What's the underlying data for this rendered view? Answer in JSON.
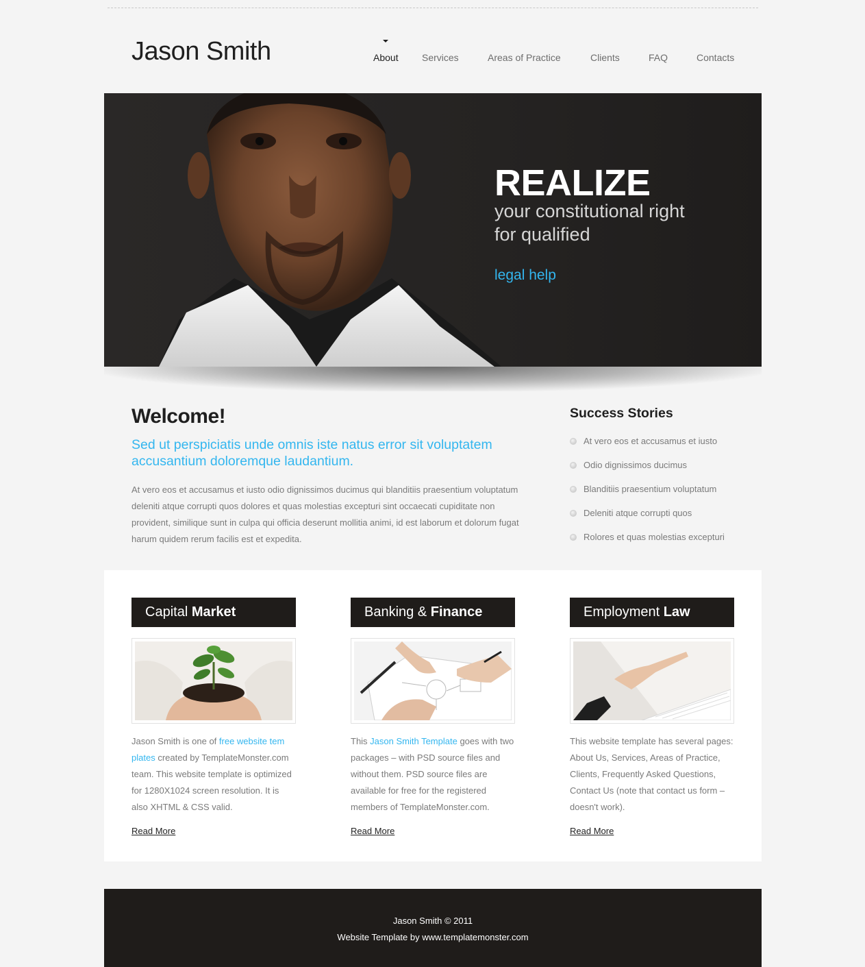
{
  "header": {
    "logo": "Jason Smith",
    "nav": [
      {
        "label": "About",
        "active": true
      },
      {
        "label": "Services",
        "active": false
      },
      {
        "label": "Areas of Practice",
        "active": false
      },
      {
        "label": "Clients",
        "active": false
      },
      {
        "label": "FAQ",
        "active": false
      },
      {
        "label": "Contacts",
        "active": false
      }
    ]
  },
  "hero": {
    "title": "REALIZE",
    "line1": "your constitutional right",
    "line2": "for qualified",
    "link": "legal help"
  },
  "welcome": {
    "title": "Welcome!",
    "lead": "Sed ut perspiciatis unde omnis iste natus error sit voluptatem accusantium doloremque laudantium.",
    "body": "At vero eos et accusamus et iusto odio dignissimos ducimus qui blanditiis praesentium voluptatum deleniti atque corrupti quos dolores et quas molestias excepturi sint occaecati cupiditate non provident, similique sunt in culpa qui officia deserunt mollitia animi, id est laborum et dolorum fugat harum quidem rerum facilis est et expedita."
  },
  "stories": {
    "title": "Success Stories",
    "items": [
      "At vero eos et accusamus et iusto",
      "Odio dignissimos ducimus",
      "Blanditiis praesentium voluptatum",
      "Deleniti atque corrupti quos",
      "Rolores et quas molestias excepturi"
    ]
  },
  "columns": [
    {
      "title_light": "Capital ",
      "title_bold": "Market",
      "text_before": "Jason Smith is one of ",
      "link_text": "free website tem plates",
      "text_after": " created by TemplateMonster.com team. This website template is optimized for 1280X1024 screen resolution. It is also XHTML & CSS valid.",
      "more": "Read More"
    },
    {
      "title_light": "Banking & ",
      "title_bold": "Finance",
      "text_before": "This ",
      "link_text": "Jason Smith Template",
      "text_after": " goes with two packages – with PSD source files and without them. PSD source files are available for free for the registered members of TemplateMonster.com.",
      "more": "Read More"
    },
    {
      "title_light": "Employment ",
      "title_bold": "Law",
      "text_before": "This website template has several pages: About Us, Services, Areas of Practice, Clients, Frequently Asked Questions, Contact Us (note that contact us form – doesn't work).",
      "link_text": "",
      "text_after": "",
      "more": "Read More"
    }
  ],
  "footer": {
    "line1": "Jason Smith © 2011",
    "line2": "Website Template by www.templatemonster.com"
  },
  "colors": {
    "accent": "#33b6ef",
    "dark": "#1f1c1a",
    "background": "#f4f4f4"
  }
}
